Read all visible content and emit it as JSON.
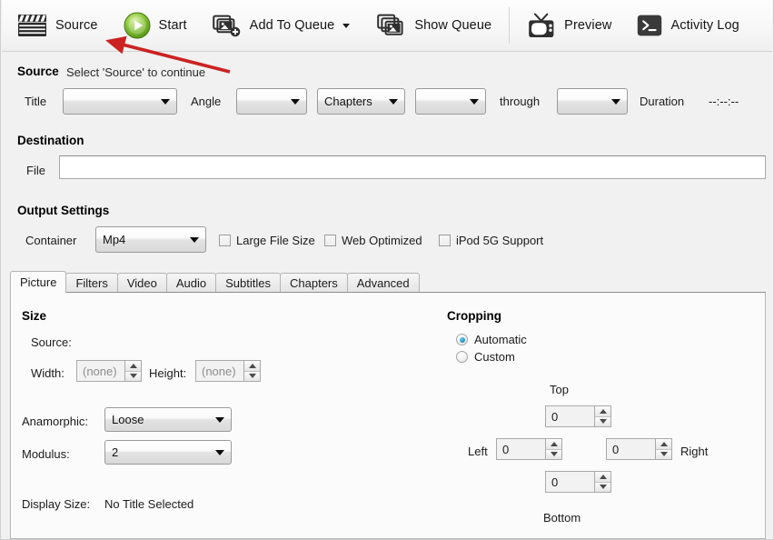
{
  "toolbar": {
    "items": [
      {
        "id": "source",
        "label": "Source",
        "icon": "clapperboard-icon",
        "has_caret": false
      },
      {
        "id": "start",
        "label": "Start",
        "icon": "play-green-icon",
        "has_caret": false
      },
      {
        "id": "add-to-queue",
        "label": "Add To Queue",
        "icon": "add-queue-icon",
        "has_caret": true
      },
      {
        "id": "show-queue",
        "label": "Show Queue",
        "icon": "queue-stack-icon",
        "has_caret": false
      },
      {
        "id": "preview",
        "label": "Preview",
        "icon": "tv-icon",
        "has_caret": false
      },
      {
        "id": "activity-log",
        "label": "Activity Log",
        "icon": "terminal-icon",
        "has_caret": false
      }
    ]
  },
  "source": {
    "heading": "Source",
    "status": "Select 'Source' to continue",
    "title_label": "Title",
    "title_value": "",
    "angle_label": "Angle",
    "angle_value": "",
    "chapters_value": "Chapters",
    "chapter_start_value": "",
    "through_label": "through",
    "chapter_end_value": "",
    "duration_label": "Duration",
    "duration_value": "--:--:--"
  },
  "destination": {
    "heading": "Destination",
    "file_label": "File",
    "file_value": "",
    "file_placeholder": ""
  },
  "output_settings": {
    "heading": "Output Settings",
    "container_label": "Container",
    "container_value": "Mp4",
    "checkboxes": [
      {
        "id": "large-file-size",
        "label": "Large File Size",
        "checked": false
      },
      {
        "id": "web-optimized",
        "label": "Web Optimized",
        "checked": false
      },
      {
        "id": "ipod-5g-support",
        "label": "iPod 5G Support",
        "checked": false
      }
    ]
  },
  "tabs": [
    {
      "id": "picture",
      "label": "Picture",
      "active": true
    },
    {
      "id": "filters",
      "label": "Filters",
      "active": false
    },
    {
      "id": "video",
      "label": "Video",
      "active": false
    },
    {
      "id": "audio",
      "label": "Audio",
      "active": false
    },
    {
      "id": "subtitles",
      "label": "Subtitles",
      "active": false
    },
    {
      "id": "chapters",
      "label": "Chapters",
      "active": false
    },
    {
      "id": "advanced",
      "label": "Advanced",
      "active": false
    }
  ],
  "picture": {
    "size_heading": "Size",
    "source_label": "Source:",
    "source_value": "",
    "width_label": "Width:",
    "width_placeholder": "(none)",
    "height_label": "Height:",
    "height_placeholder": "(none)",
    "anamorphic_label": "Anamorphic:",
    "anamorphic_value": "Loose",
    "modulus_label": "Modulus:",
    "modulus_value": "2",
    "display_size_label": "Display Size:",
    "display_size_value": "No Title Selected"
  },
  "cropping": {
    "heading": "Cropping",
    "mode_automatic": "Automatic",
    "mode_custom": "Custom",
    "selected_mode": "Automatic",
    "top_label": "Top",
    "top_value": "0",
    "left_label": "Left",
    "left_value": "0",
    "right_label": "Right",
    "right_value": "0",
    "bottom_label": "Bottom",
    "bottom_value": "0"
  },
  "annotation": {
    "type": "arrow",
    "color": "#cc2222",
    "points_at": "source-button"
  }
}
